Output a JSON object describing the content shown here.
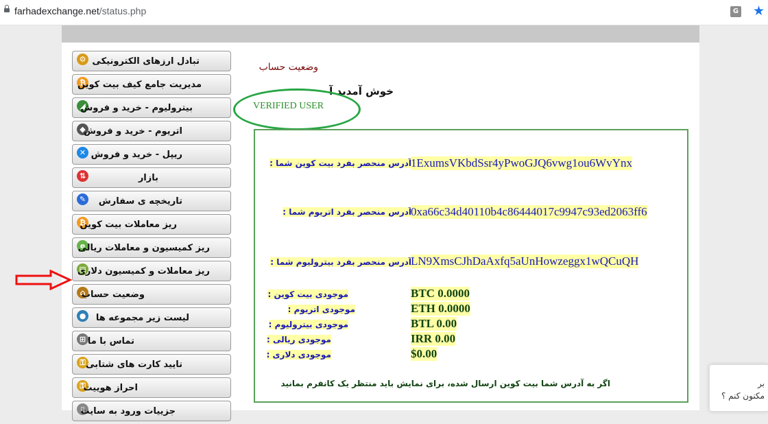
{
  "browser": {
    "url_host": "farhadexchange.net",
    "url_path": "/status.php"
  },
  "sidebar": {
    "items": [
      {
        "label": "تبادل ارزهای الکترونیکی",
        "icon": "exchange-icon",
        "color": "#d89a1a"
      },
      {
        "label": "مدیریت جامع کیف بیت کوین",
        "icon": "bitcoin-icon",
        "color": "#f29a1f"
      },
      {
        "label": "بیترولیوم - خرید و فروش",
        "icon": "bitrolium-icon",
        "color": "#3a8f3a"
      },
      {
        "label": "اتریوم - خرید و فروش",
        "icon": "ethereum-icon",
        "color": "#555555"
      },
      {
        "label": "ریپل - خرید و فروش",
        "icon": "ripple-icon",
        "color": "#1e88e5"
      },
      {
        "label": "بازار",
        "icon": "market-icon",
        "color": "#d33"
      },
      {
        "label": "تاریخچه ی سفارش",
        "icon": "history-icon",
        "color": "#2b6cd8"
      },
      {
        "label": "ریز معاملات بیت کوین",
        "icon": "bitcoin-icon",
        "color": "#f29a1f"
      },
      {
        "label": "ریز کمیسیون و معاملات ریالی",
        "icon": "rial-icon",
        "color": "#66b34a"
      },
      {
        "label": "ریز معاملات و کمیسیون دلاری",
        "icon": "dollar-icon",
        "color": "#7ba939"
      },
      {
        "label": "وضعیت حساب",
        "icon": "home-icon",
        "color": "#b57a18"
      },
      {
        "label": "لیست زیر مجموعه ها",
        "icon": "globe-icon",
        "color": "#2e7fb8"
      },
      {
        "label": "تماس با ما",
        "icon": "network-icon",
        "color": "#777777"
      },
      {
        "label": "تایید کارت های شتابی",
        "icon": "key-icon",
        "color": "#d9a21b"
      },
      {
        "label": "احراز هوییت",
        "icon": "key-icon",
        "color": "#d9a21b"
      },
      {
        "label": "جزییات ورود به سایت",
        "icon": "document-icon",
        "color": "#888888"
      }
    ]
  },
  "main": {
    "title": "وضعیت حساب",
    "welcome": "خوش آمدید آ",
    "verified": "VERIFIED USER"
  },
  "account": {
    "btc_address_label": "آدرس منحصر بفرد بیت کوین شما :",
    "btc_address": "1ExumsVKbdSsr4yPwoGJQ6vwg1ou6WvYnx",
    "eth_address_label": "آدرس منحصر بفرد اتریوم شما :",
    "eth_address": "0xa66c34d40110b4c86444017c9947c93ed2063ff6",
    "btl_address_label": "آدرس منحصر بفرد بیترولیوم شما :",
    "btl_address": "LN9XmsCJhDaAxfq5aUnHowzeggx1wQCuQH",
    "balances": [
      {
        "label": "موجودی بیت کوین :",
        "value": "BTC 0.0000"
      },
      {
        "label": "موجودی اتریوم :",
        "value": "ETH 0.0000"
      },
      {
        "label": "موجودی بیترولیوم :",
        "value": "BTL 0.00"
      },
      {
        "label": "موجودی ریالی :",
        "value": "IRR 0.00"
      },
      {
        "label": "موجودی دلاری :",
        "value": "$0.00"
      }
    ],
    "note": "اگر به آدرس شما بیت کوین ارسال شده، برای نمایش باید منتظر یک کانفرم بمانید"
  },
  "chat_widget": {
    "line1": "بر",
    "line2": "مکنون کنم ؟"
  }
}
